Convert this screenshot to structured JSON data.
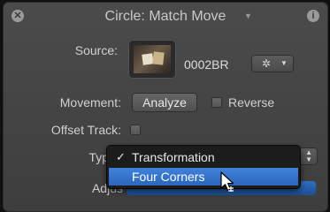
{
  "window": {
    "title": "Circle: Match Move",
    "close_icon": "close-icon",
    "info_icon": "info-icon"
  },
  "source": {
    "label": "Source:",
    "clip_name": "0002BR",
    "gear_icon": "gear-icon"
  },
  "movement": {
    "label": "Movement:",
    "analyze_label": "Analyze",
    "reverse_label": "Reverse",
    "reverse_checked": false
  },
  "offset_track": {
    "label": "Offset Track:",
    "checked": false
  },
  "type": {
    "label_visible": "Typ",
    "menu_items": [
      {
        "label": "Transformation",
        "checked": true
      },
      {
        "label": "Four Corners",
        "checked": false,
        "highlighted": true
      }
    ]
  },
  "adjust": {
    "label_visible": "Adjus"
  },
  "colors": {
    "panel": "#444444",
    "menu_highlight": "#3577cf",
    "slider_fill": "#2a62ad"
  }
}
